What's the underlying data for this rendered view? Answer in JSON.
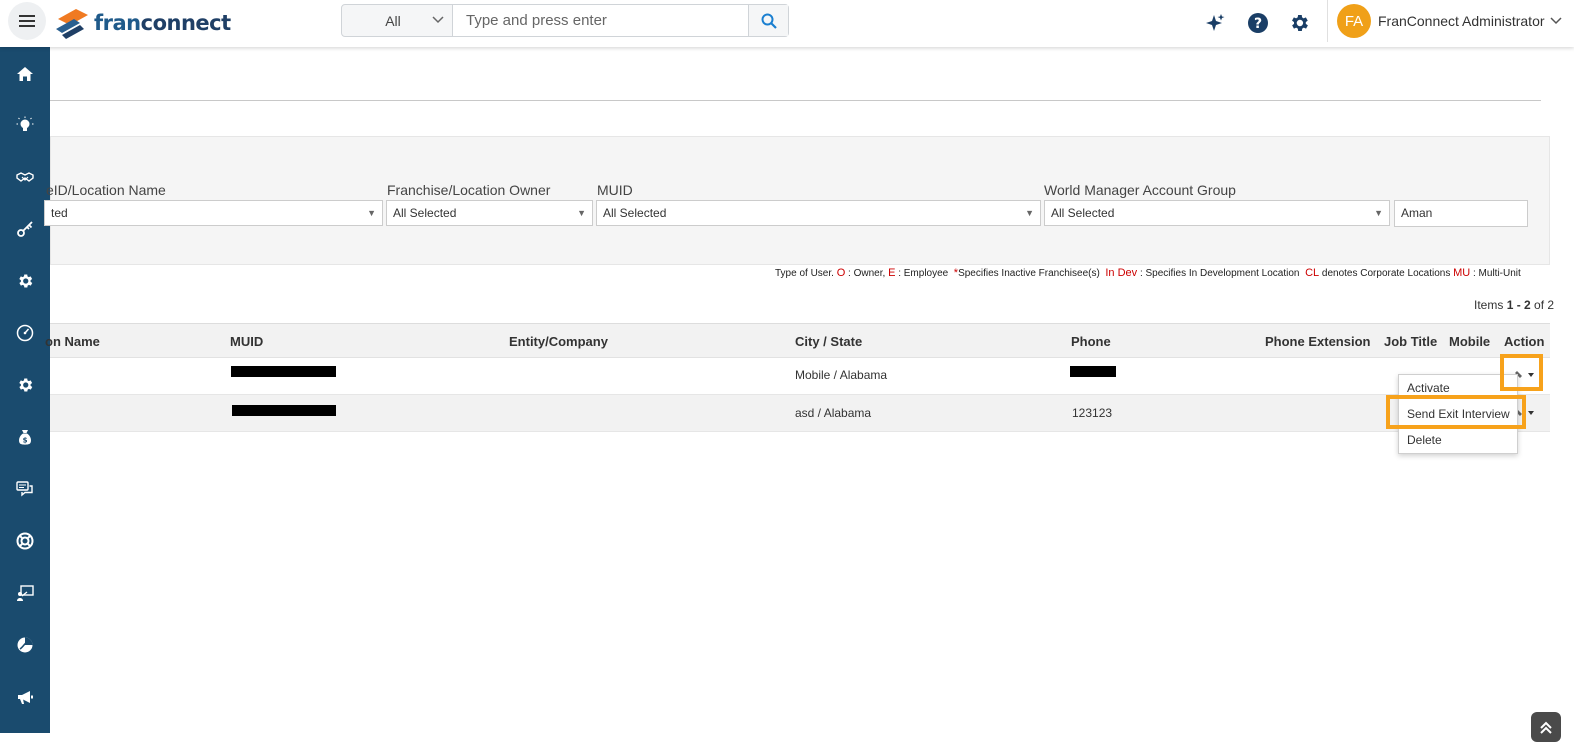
{
  "header": {
    "brand": "franconnect",
    "brand_prefix": "fran",
    "brand_suffix": "connect",
    "search_scope": "All",
    "search_placeholder": "Type and press enter",
    "user_initials": "FA",
    "user_name": "FranConnect Administrator"
  },
  "sidebar": {
    "items": [
      "home-icon",
      "lightbulb-icon",
      "handshake-icon",
      "key-icon",
      "gear-icon",
      "dashboard-icon",
      "settings-icon",
      "money-bag-icon",
      "chat-icon",
      "support-icon",
      "training-icon",
      "analytics-icon",
      "megaphone-icon"
    ]
  },
  "filters": {
    "location_label": "eID/Location Name",
    "location_value": "ted",
    "owner_label": "Franchise/Location Owner",
    "owner_value": "All Selected",
    "muid_label": "MUID",
    "muid_value": "All Selected",
    "wm_group_label": "World Manager Account Group",
    "wm_group_value": "All Selected",
    "name_value": "Aman"
  },
  "legend": {
    "type_label": "Type of User.",
    "o": "O",
    "o_text": ": Owner,",
    "e": "E",
    "e_text": ": Employee",
    "star": "*",
    "star_text": "Specifies Inactive Franchisee(s)",
    "indev": "In Dev",
    "indev_text": ": Specifies In Development Location",
    "cl": "CL",
    "cl_text": "denotes Corporate Locations",
    "mu": "MU",
    "mu_text": ": Multi-Unit"
  },
  "pagination": {
    "prefix": "Items",
    "range": "1 - 2",
    "suffix": "of 2"
  },
  "table": {
    "headers": [
      "on Name",
      "MUID",
      "Entity/Company",
      "City / State",
      "Phone",
      "Phone Extension",
      "Job Title",
      "Mobile",
      "Action"
    ],
    "rows": [
      {
        "city_state": "Mobile / Alabama",
        "phone": ""
      },
      {
        "city_state": "asd / Alabama",
        "phone": "123123"
      }
    ]
  },
  "action_menu": {
    "items": [
      "Activate",
      "Send Exit Interview",
      "Delete"
    ]
  },
  "colors": {
    "sidebar": "#1a4b6e",
    "highlight": "#f7a21b",
    "avatar": "#f0a018",
    "legend_red": "#cc0000"
  }
}
